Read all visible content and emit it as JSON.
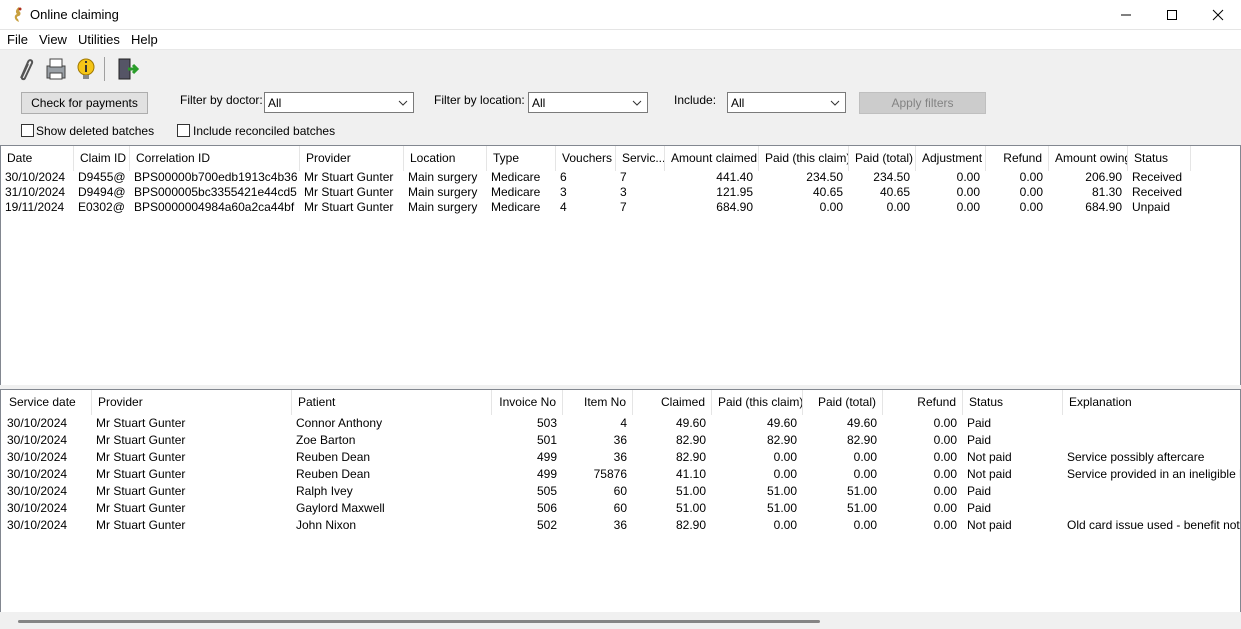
{
  "window": {
    "title": "Online claiming"
  },
  "menu": [
    "File",
    "View",
    "Utilities",
    "Help"
  ],
  "toolbar": {
    "icons": [
      "paperclip-icon",
      "printer-icon",
      "info-bulb-icon",
      "exit-door-icon"
    ]
  },
  "filters": {
    "check_payments_label": "Check for payments",
    "doctor_label": "Filter by doctor:",
    "doctor_value": "All",
    "location_label": "Filter by location:",
    "location_value": "All",
    "include_label": "Include:",
    "include_value": "All",
    "apply_label": "Apply filters",
    "show_deleted_label": "Show deleted batches",
    "include_reconciled_label": "Include reconciled batches"
  },
  "batches": {
    "columns": [
      "Date",
      "Claim ID",
      "Correlation ID",
      "Provider",
      "Location",
      "Type",
      "Vouchers",
      "Servic...",
      "Amount claimed",
      "Paid (this claim)",
      "Paid (total)",
      "Adjustment",
      "Refund",
      "Amount owing",
      "Status"
    ],
    "rows": [
      [
        "30/10/2024",
        "D9455@",
        "BPS00000b700edb1913c4b36",
        "Mr Stuart Gunter",
        "Main surgery",
        "Medicare",
        "6",
        "7",
        "441.40",
        "234.50",
        "234.50",
        "0.00",
        "0.00",
        "206.90",
        "Received"
      ],
      [
        "31/10/2024",
        "D9494@",
        "BPS000005bc3355421e44cd5",
        "Mr Stuart Gunter",
        "Main surgery",
        "Medicare",
        "3",
        "3",
        "121.95",
        "40.65",
        "40.65",
        "0.00",
        "0.00",
        "81.30",
        "Received"
      ],
      [
        "19/11/2024",
        "E0302@",
        "BPS0000004984a60a2ca44bf",
        "Mr Stuart Gunter",
        "Main surgery",
        "Medicare",
        "4",
        "7",
        "684.90",
        "0.00",
        "0.00",
        "0.00",
        "0.00",
        "684.90",
        "Unpaid"
      ]
    ]
  },
  "services": {
    "columns": [
      "Service date",
      "Provider",
      "Patient",
      "Invoice No",
      "Item No",
      "Claimed",
      "Paid (this claim)",
      "Paid (total)",
      "Refund",
      "Status",
      "Explanation"
    ],
    "rows": [
      [
        "30/10/2024",
        "Mr Stuart Gunter",
        "Connor Anthony",
        "503",
        "4",
        "49.60",
        "49.60",
        "49.60",
        "0.00",
        "Paid",
        ""
      ],
      [
        "30/10/2024",
        "Mr Stuart Gunter",
        "Zoe Barton",
        "501",
        "36",
        "82.90",
        "82.90",
        "82.90",
        "0.00",
        "Paid",
        ""
      ],
      [
        "30/10/2024",
        "Mr Stuart Gunter",
        "Reuben Dean",
        "499",
        "36",
        "82.90",
        "0.00",
        "0.00",
        "0.00",
        "Not paid",
        "Service possibly aftercare"
      ],
      [
        "30/10/2024",
        "Mr Stuart Gunter",
        "Reuben Dean",
        "499",
        "75876",
        "41.10",
        "0.00",
        "0.00",
        "0.00",
        "Not paid",
        "Service provided in an ineligible loca"
      ],
      [
        "30/10/2024",
        "Mr Stuart Gunter",
        "Ralph Ivey",
        "505",
        "60",
        "51.00",
        "51.00",
        "51.00",
        "0.00",
        "Paid",
        ""
      ],
      [
        "30/10/2024",
        "Mr Stuart Gunter",
        "Gaylord Maxwell",
        "506",
        "60",
        "51.00",
        "51.00",
        "51.00",
        "0.00",
        "Paid",
        ""
      ],
      [
        "30/10/2024",
        "Mr Stuart Gunter",
        "John Nixon",
        "502",
        "36",
        "82.90",
        "0.00",
        "0.00",
        "0.00",
        "Not paid",
        "Old card issue used - benefit not pay"
      ]
    ]
  }
}
